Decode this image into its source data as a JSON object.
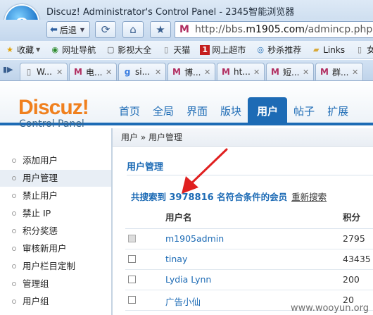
{
  "browser": {
    "window_title": "Discuz! Administrator's Control Panel - 2345智能浏览器",
    "back_label": "后退",
    "address_host": "http://bbs.",
    "address_domain": "m1905.com",
    "address_path": "/admincp.php?f",
    "favorites": [
      {
        "icon": "star-icon",
        "label": "收藏"
      },
      {
        "icon": "globe-icon",
        "label": "网址导航"
      },
      {
        "icon": "film-icon",
        "label": "影视大全"
      },
      {
        "icon": "page-icon",
        "label": "天猫"
      },
      {
        "icon": "shop-icon",
        "label": "网上超市"
      },
      {
        "icon": "speed-icon",
        "label": "秒杀推荐"
      },
      {
        "icon": "folder-icon",
        "label": "Links"
      },
      {
        "icon": "page-icon",
        "label": "女"
      }
    ],
    "tabs": [
      {
        "label": "W..."
      },
      {
        "label": "电..."
      },
      {
        "label": "si..."
      },
      {
        "label": "博..."
      },
      {
        "label": "ht..."
      },
      {
        "label": "短..."
      },
      {
        "label": "群..."
      }
    ]
  },
  "discuz": {
    "logo": "Discuz!",
    "subtitle": "Control Panel",
    "top_nav": [
      "首页",
      "全局",
      "界面",
      "版块",
      "用户",
      "帖子",
      "扩展"
    ],
    "active_nav": "用户"
  },
  "sidebar": {
    "items": [
      {
        "label": "添加用户",
        "active": false
      },
      {
        "label": "用户管理",
        "active": true
      },
      {
        "label": "禁止用户",
        "active": false
      },
      {
        "label": "禁止 IP",
        "active": false
      },
      {
        "label": "积分奖惩",
        "active": false
      },
      {
        "label": "审核新用户",
        "active": false
      },
      {
        "label": "用户栏目定制",
        "active": false
      },
      {
        "label": "管理组",
        "active": false
      },
      {
        "label": "用户组",
        "active": false
      }
    ]
  },
  "main": {
    "breadcrumb": "用户 » 用户管理",
    "section_title": "用户管理",
    "result_prefix": "共搜索到",
    "result_count": "3978816",
    "result_suffix": "名符合条件的会员",
    "research_link": "重新搜索",
    "table": {
      "col_username": "用户名",
      "col_score": "积分",
      "rows": [
        {
          "username": "m1905admin",
          "score": "2795",
          "checkbox_disabled": true
        },
        {
          "username": "tinay",
          "score": "43435",
          "checkbox_disabled": false
        },
        {
          "username": "Lydia Lynn",
          "score": "200",
          "checkbox_disabled": false
        },
        {
          "username": "广告小仙",
          "score": "20",
          "checkbox_disabled": false
        }
      ]
    }
  },
  "watermark": "www.wooyun.org",
  "colors": {
    "accent": "#1d6bb5",
    "logo_orange": "#f0801e",
    "annotation_red": "#e02020"
  }
}
